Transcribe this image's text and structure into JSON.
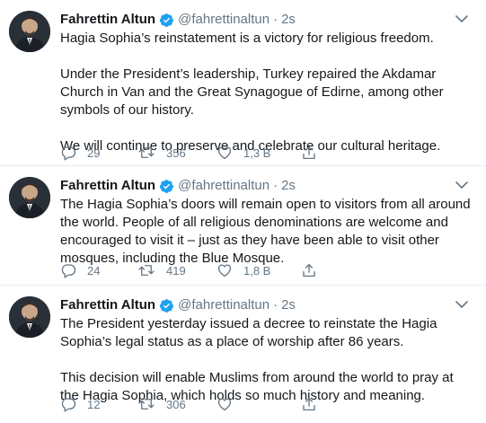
{
  "author": {
    "name": "Fahrettin Altun",
    "handle": "@fahrettinaltun",
    "separator": "·",
    "verified_icon": "verified-badge-icon"
  },
  "colors": {
    "text": "#14171a",
    "secondary": "#657786",
    "verified": "#1da1f2",
    "divider": "#e6ecf0"
  },
  "tweets": [
    {
      "time": "2s",
      "paragraphs": [
        "Hagia Sophia’s reinstatement is a victory for religious freedom.",
        "Under the President’s leadership, Turkey repaired the Akdamar Church in Van and the Great Synagogue of Edirne, among other symbols of our history.",
        "We will continue to preserve and celebrate our cultural heritage."
      ],
      "replies": "29",
      "retweets": "356",
      "likes": "1,3 B"
    },
    {
      "time": "2s",
      "paragraphs": [
        "The Hagia Sophia’s doors will remain open to visitors from all around the world. People of all religious denominations are welcome and encouraged to visit it – just as they have been able to visit other mosques, including the Blue Mosque."
      ],
      "replies": "24",
      "retweets": "419",
      "likes": "1,8 B"
    },
    {
      "time": "2s",
      "paragraphs": [
        "The President yesterday issued a decree to reinstate the Hagia Sophia’s legal status as a place of worship after 86 years.",
        "This decision will enable Muslims from around the world to pray at the Hagia Sophia, which holds so much history and meaning."
      ],
      "replies": "12",
      "retweets": "306",
      "likes": ""
    }
  ]
}
